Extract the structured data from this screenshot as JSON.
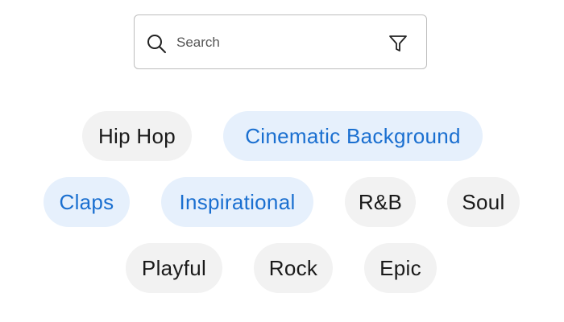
{
  "search": {
    "placeholder": "Search",
    "value": ""
  },
  "icons": {
    "search": "search-icon",
    "filter": "filter-icon"
  },
  "colors": {
    "chip_bg": "#f2f2f2",
    "chip_text": "#1a1a1a",
    "chip_selected_bg": "#e6f0fc",
    "chip_selected_text": "#1a6fd0",
    "border": "#bdbdbd"
  },
  "tags": [
    {
      "label": "Hip Hop",
      "selected": false
    },
    {
      "label": "Cinematic Background",
      "selected": true
    },
    {
      "label": "Claps",
      "selected": true
    },
    {
      "label": "Inspirational",
      "selected": true
    },
    {
      "label": "R&B",
      "selected": false
    },
    {
      "label": "Soul",
      "selected": false
    },
    {
      "label": "Playful",
      "selected": false
    },
    {
      "label": "Rock",
      "selected": false
    },
    {
      "label": "Epic",
      "selected": false
    }
  ]
}
